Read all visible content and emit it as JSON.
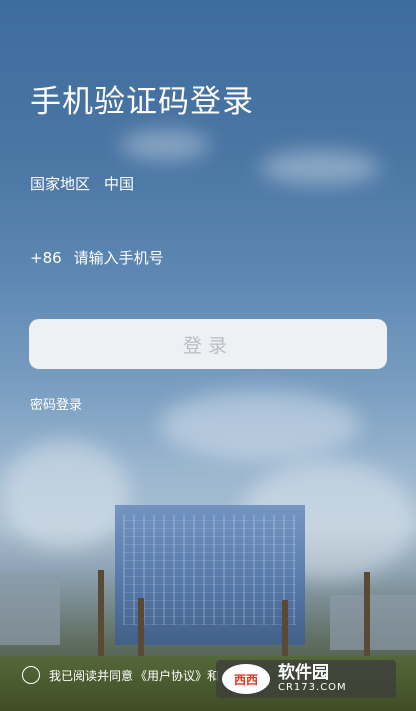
{
  "title": "手机验证码登录",
  "region": {
    "label": "国家地区",
    "value": "中国"
  },
  "phone": {
    "country_code": "+86",
    "placeholder": "请输入手机号"
  },
  "login_button": "登录",
  "password_login": "密码登录",
  "agreement": {
    "prefix": "我已阅读并同意",
    "user_agreement": "《用户协议》",
    "suffix": "和"
  },
  "watermark": {
    "logo": "西西",
    "name": "软件园",
    "url": "CR173.COM"
  },
  "colors": {
    "sky_top": "#3e6c9d",
    "button_bg": "#eef0f4",
    "button_text": "#b9bec6"
  }
}
